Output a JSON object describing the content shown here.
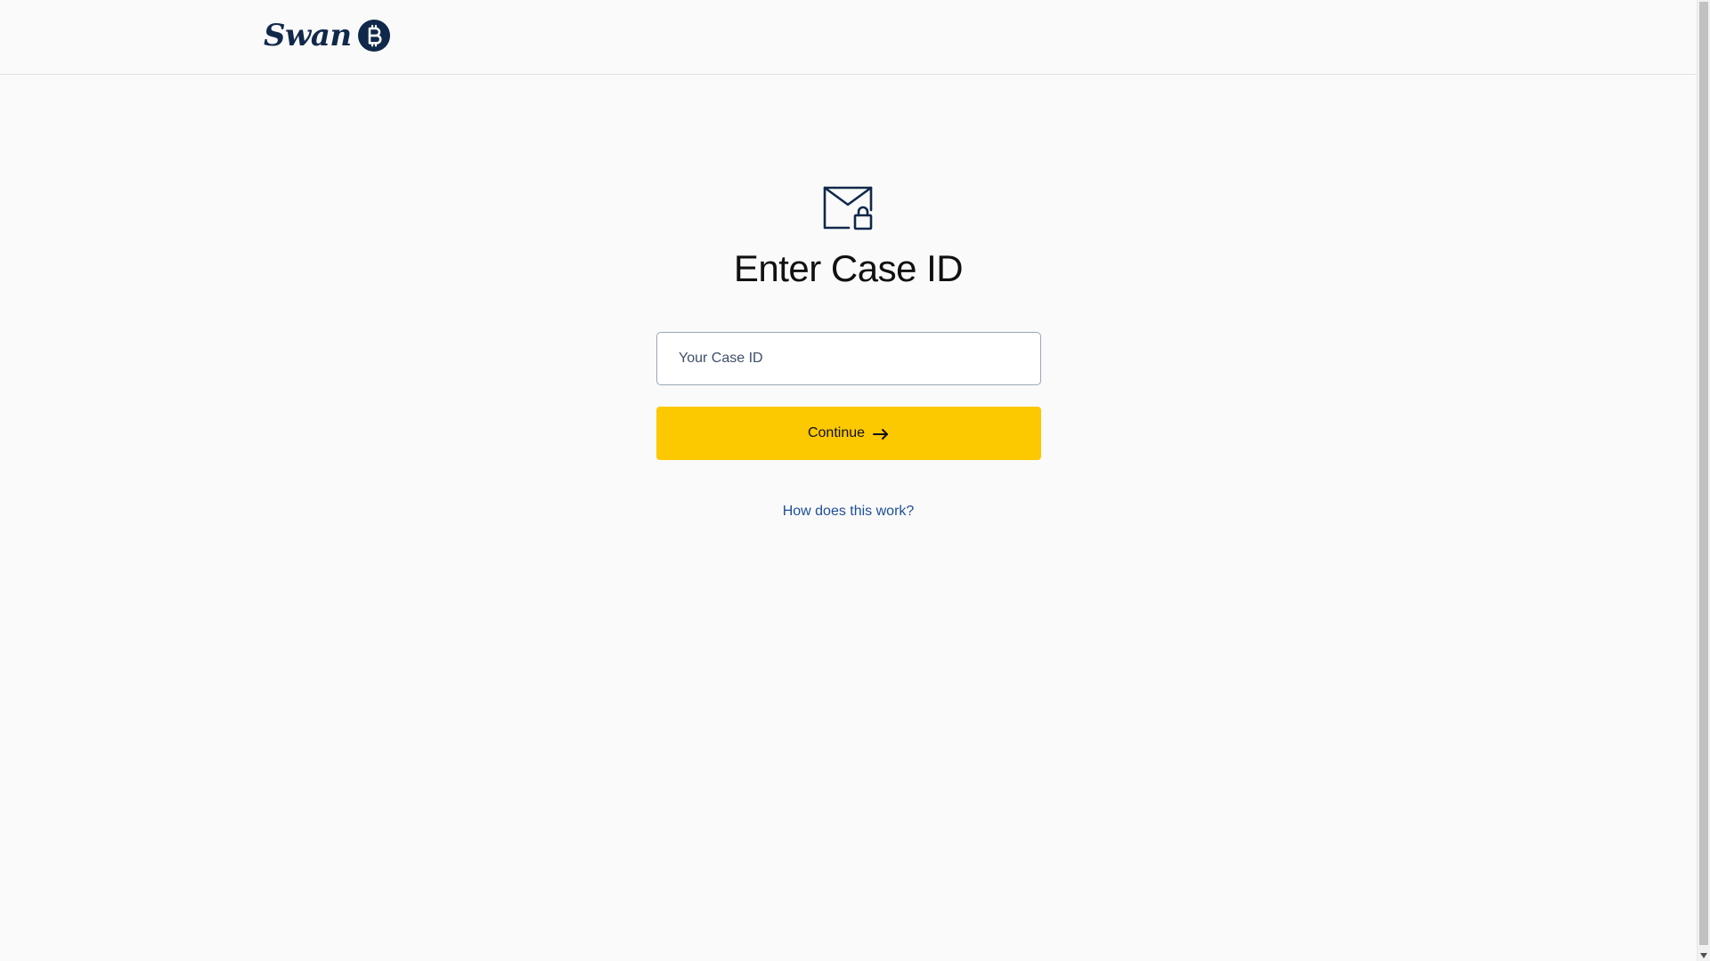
{
  "header": {
    "logo_text": "Swan",
    "logo_mark": "bitcoin-coin-icon",
    "brand_color": "#10284a"
  },
  "main": {
    "icon": "mail-lock-icon",
    "title": "Enter Case ID",
    "case_input": {
      "placeholder": "Your Case ID",
      "value": ""
    },
    "continue_button": {
      "label": "Continue",
      "icon": "arrow-right-icon",
      "color": "#fcc800"
    },
    "help_link": "How does this work?"
  },
  "colors": {
    "background": "#fafafa",
    "accent_yellow": "#fcc800",
    "link_blue": "#1d4f96",
    "navy": "#10284a"
  }
}
